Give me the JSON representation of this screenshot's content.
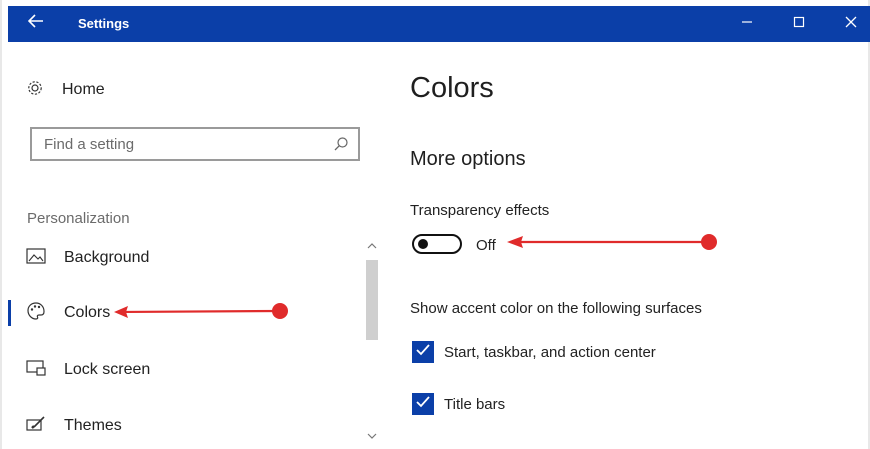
{
  "window": {
    "title": "Settings",
    "accent": "#0b3fa8"
  },
  "sidebar": {
    "home_label": "Home",
    "search_placeholder": "Find a setting",
    "section_heading": "Personalization",
    "items": [
      {
        "label": "Background",
        "icon": "image-icon"
      },
      {
        "label": "Colors",
        "icon": "palette-icon",
        "selected": true
      },
      {
        "label": "Lock screen",
        "icon": "lock-screen-icon"
      },
      {
        "label": "Themes",
        "icon": "brush-icon"
      }
    ]
  },
  "main": {
    "title": "Colors",
    "subtitle": "More options",
    "transparency": {
      "label": "Transparency effects",
      "state_label": "Off",
      "on": false
    },
    "accent_surfaces_label": "Show accent color on the following surfaces",
    "checkboxes": [
      {
        "label": "Start, taskbar, and action center",
        "checked": true
      },
      {
        "label": "Title bars",
        "checked": true
      }
    ]
  },
  "annotations": {
    "arrow_color": "#e02b2b"
  }
}
